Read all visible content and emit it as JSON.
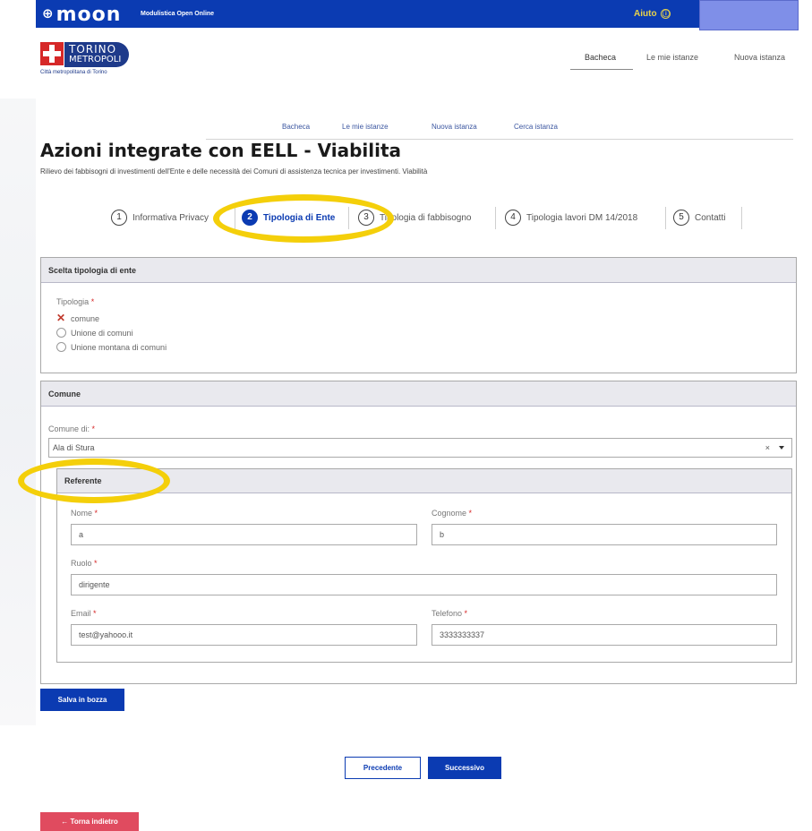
{
  "topbar": {
    "logo": "moon",
    "subtitle": "Modulistica Open Online",
    "help": "Aiuto",
    "help_icon": "ⓘ"
  },
  "brand": {
    "line1": "TORINO",
    "line2": "METROPOLI",
    "line3": "Città metropolitana di Torino"
  },
  "main_nav": [
    "Bacheca",
    "Le mie istanze",
    "Nuova istanza"
  ],
  "sub_nav": [
    "Bacheca",
    "Le mie istanze",
    "Nuova istanza",
    "Cerca istanza"
  ],
  "page": {
    "title": "Azioni integrate con EELL - Viabilita",
    "description": "Rilievo dei fabbisogni di investimenti dell'Ente e delle necessità dei Comuni di assistenza tecnica per investimenti. Viabilità"
  },
  "steps": [
    {
      "num": "1",
      "label": "Informativa Privacy"
    },
    {
      "num": "2",
      "label": "Tipologia di Ente"
    },
    {
      "num": "3",
      "label": "Tipologia di fabbisogno"
    },
    {
      "num": "4",
      "label": "Tipologia lavori DM 14/2018"
    },
    {
      "num": "5",
      "label": "Contatti"
    }
  ],
  "panel_tipologia": {
    "header": "Scelta tipologia di ente",
    "label": "Tipologia",
    "required": "*",
    "options": [
      "comune",
      "Unione di comuni",
      "Unione montana di comuni"
    ],
    "selected": "comune"
  },
  "panel_comune": {
    "header": "Comune",
    "label": "Comune di:",
    "required": "*",
    "value": "Ala di Stura",
    "clear": "×"
  },
  "referente": {
    "header": "Referente",
    "nome_label": "Nome",
    "nome_value": "a",
    "cognome_label": "Cognome",
    "cognome_value": "b",
    "ruolo_label": "Ruolo",
    "ruolo_value": "dirigente",
    "email_label": "Email",
    "email_value": "test@yahooo.it",
    "telefono_label": "Telefono",
    "telefono_value": "3333333337",
    "required": "*"
  },
  "buttons": {
    "save_draft": "Salva in bozza",
    "previous": "Precedente",
    "next": "Successivo",
    "back": "← Torna indietro"
  },
  "colors": {
    "primary": "#0b3bb2",
    "highlight": "#f4cf0a",
    "danger": "#e04b5f",
    "required": "#d62828"
  }
}
